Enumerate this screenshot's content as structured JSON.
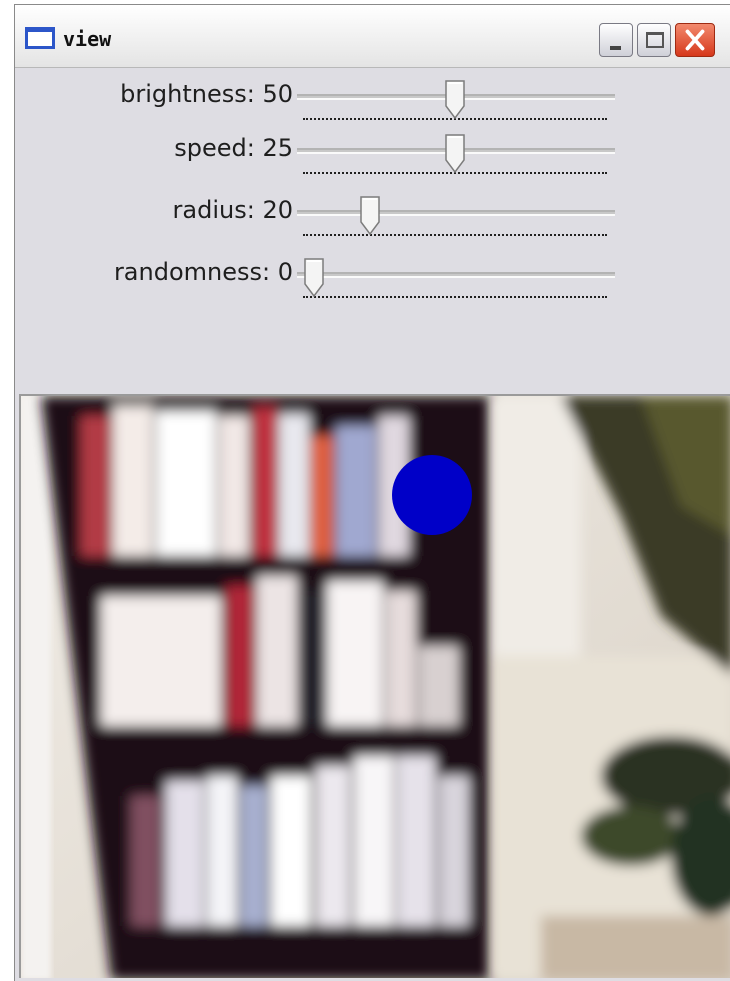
{
  "window": {
    "title": "view",
    "icon": "window-icon",
    "buttons": {
      "minimize": "minimize-icon",
      "maximize": "maximize-icon",
      "close": "close-icon"
    }
  },
  "sliders": [
    {
      "label": "brightness: 50",
      "value": 50,
      "max": 100
    },
    {
      "label": "speed: 25",
      "value": 25,
      "max": 50
    },
    {
      "label": "radius: 20",
      "value": 20,
      "max": 100
    },
    {
      "label": "randomness: 0",
      "value": 0,
      "max": 100
    }
  ],
  "camera": {
    "overlay_circle_color": "#0000c8"
  }
}
